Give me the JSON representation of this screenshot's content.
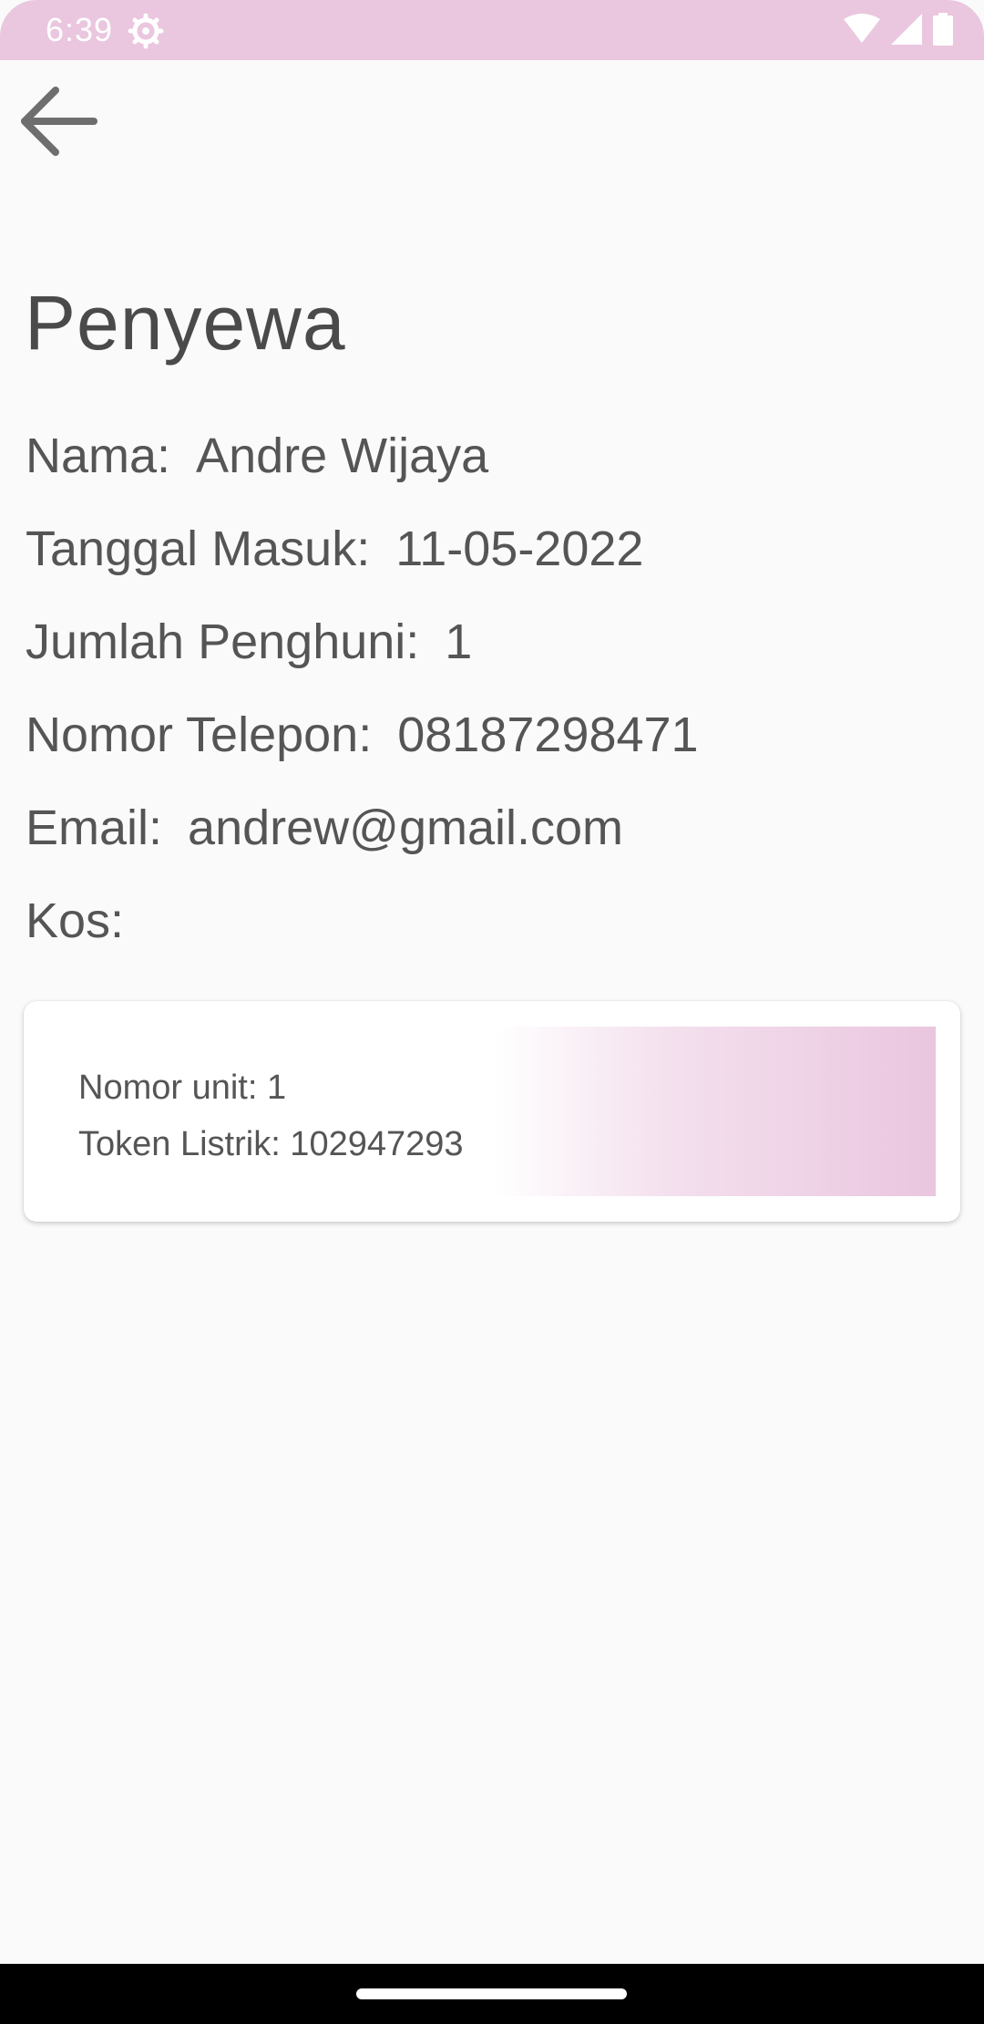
{
  "status_bar": {
    "time": "6:39",
    "settings_icon": "gear-icon",
    "wifi_icon": "wifi-icon",
    "signal_icon": "signal-icon",
    "battery_icon": "battery-icon",
    "background_color": "#eac6df"
  },
  "header": {
    "back_icon": "arrow-back-icon"
  },
  "page": {
    "title": "Penyewa"
  },
  "fields": {
    "nama": {
      "label": "Nama:",
      "value": "Andre Wijaya"
    },
    "tanggal_masuk": {
      "label": "Tanggal Masuk:",
      "value": "11-05-2022"
    },
    "jumlah_penghuni": {
      "label": "Jumlah Penghuni:",
      "value": "1"
    },
    "nomor_telepon": {
      "label": "Nomor Telepon:",
      "value": "08187298471"
    },
    "email": {
      "label": "Email:",
      "value": "andrew@gmail.com"
    },
    "kos": {
      "label": "Kos:",
      "value": ""
    }
  },
  "kos_card": {
    "nomor_unit": "Nomor unit: 1",
    "token_listrik": "Token Listrik: 102947293",
    "accent_color": "#eac6df"
  }
}
